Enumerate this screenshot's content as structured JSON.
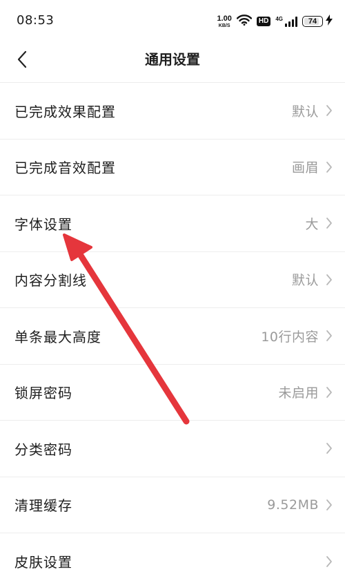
{
  "status_bar": {
    "time": "08:53",
    "net_speed_value": "1.00",
    "net_speed_unit": "KB/S",
    "hd_badge": "HD",
    "signal_label": "4G",
    "battery_level": "74",
    "icons": [
      "wifi-icon",
      "hd-icon",
      "signal-icon",
      "battery-icon",
      "charging-icon"
    ]
  },
  "header": {
    "title": "通用设置",
    "back_icon": "chevron-left-icon"
  },
  "settings": [
    {
      "label": "已完成效果配置",
      "value": "默认"
    },
    {
      "label": "已完成音效配置",
      "value": "画眉"
    },
    {
      "label": "字体设置",
      "value": "大"
    },
    {
      "label": "内容分割线",
      "value": "默认"
    },
    {
      "label": "单条最大高度",
      "value": "10行内容"
    },
    {
      "label": "锁屏密码",
      "value": "未启用"
    },
    {
      "label": "分类密码",
      "value": ""
    },
    {
      "label": "清理缓存",
      "value": "9.52MB"
    },
    {
      "label": "皮肤设置",
      "value": ""
    }
  ],
  "colors": {
    "annotation_arrow": "#e5363c",
    "value_text": "#9a9a9a",
    "divider": "#ededed"
  }
}
